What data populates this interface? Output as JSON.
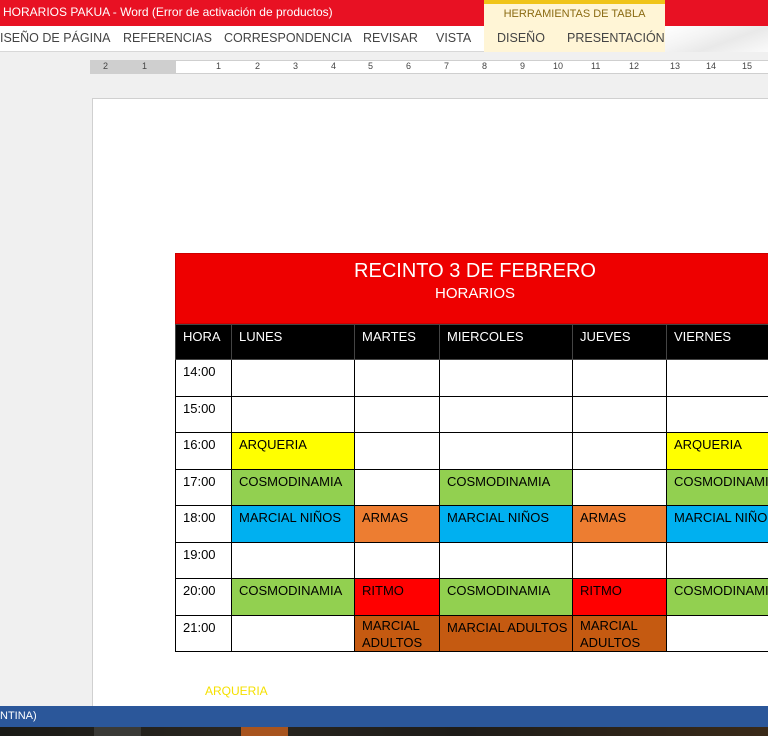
{
  "window": {
    "title": "HORARIOS PAKUA -  Word (Error de activación de productos)",
    "context_tab_group": "HERRAMIENTAS DE TABLA"
  },
  "ribbon": {
    "tabs": [
      "ISEÑO DE PÁGINA",
      "REFERENCIAS",
      "CORRESPONDENCIA",
      "REVISAR",
      "VISTA",
      "DISEÑO",
      "PRESENTACIÓN"
    ]
  },
  "ruler": {
    "numbers": [
      "2",
      "1",
      "1",
      "2",
      "3",
      "4",
      "5",
      "6",
      "7",
      "8",
      "9",
      "10",
      "11",
      "12",
      "13",
      "14",
      "15"
    ]
  },
  "schedule": {
    "title": "RECINTO 3 DE FEBRERO",
    "subtitle": "HORARIOS",
    "columns": [
      "HORA",
      "LUNES",
      "MARTES",
      "MIERCOLES",
      "JUEVES",
      "VIERNES"
    ],
    "rows": [
      {
        "hora": "14:00",
        "cells": [
          {
            "text": "",
            "color": ""
          },
          {
            "text": "",
            "color": ""
          },
          {
            "text": "",
            "color": ""
          },
          {
            "text": "",
            "color": ""
          },
          {
            "text": "",
            "color": ""
          }
        ]
      },
      {
        "hora": "15:00",
        "cells": [
          {
            "text": "",
            "color": ""
          },
          {
            "text": "",
            "color": ""
          },
          {
            "text": "",
            "color": ""
          },
          {
            "text": "",
            "color": ""
          },
          {
            "text": "",
            "color": ""
          }
        ]
      },
      {
        "hora": "16:00",
        "cells": [
          {
            "text": "ARQUERIA",
            "color": "yellow"
          },
          {
            "text": "",
            "color": ""
          },
          {
            "text": "",
            "color": ""
          },
          {
            "text": "",
            "color": ""
          },
          {
            "text": "ARQUERIA",
            "color": "yellow"
          }
        ]
      },
      {
        "hora": "17:00",
        "cells": [
          {
            "text": "COSMODINAMIA",
            "color": "green"
          },
          {
            "text": "",
            "color": ""
          },
          {
            "text": "COSMODINAMIA",
            "color": "green"
          },
          {
            "text": "",
            "color": ""
          },
          {
            "text": "COSMODINAMIA",
            "color": "green"
          }
        ]
      },
      {
        "hora": "18:00",
        "cells": [
          {
            "text": "MARCIAL NIÑOS",
            "color": "blue"
          },
          {
            "text": "ARMAS",
            "color": "orange"
          },
          {
            "text": "MARCIAL NIÑOS",
            "color": "blue"
          },
          {
            "text": "ARMAS",
            "color": "orange"
          },
          {
            "text": "MARCIAL NIÑOS",
            "color": "blue"
          }
        ]
      },
      {
        "hora": "19:00",
        "cells": [
          {
            "text": "",
            "color": ""
          },
          {
            "text": "",
            "color": ""
          },
          {
            "text": "",
            "color": ""
          },
          {
            "text": "",
            "color": ""
          },
          {
            "text": "",
            "color": ""
          }
        ]
      },
      {
        "hora": "20:00",
        "cells": [
          {
            "text": "COSMODINAMIA",
            "color": "green"
          },
          {
            "text": "RITMO",
            "color": "red"
          },
          {
            "text": "COSMODINAMIA",
            "color": "green"
          },
          {
            "text": "RITMO",
            "color": "red"
          },
          {
            "text": "COSMODINAMIA",
            "color": "green"
          }
        ]
      },
      {
        "hora": "21:00",
        "cells": [
          {
            "text": "",
            "color": ""
          },
          {
            "text": "MARCIAL ADULTOS",
            "color": "brown"
          },
          {
            "text": "MARCIAL ADULTOS",
            "color": "brown"
          },
          {
            "text": "MARCIAL ADULTOS",
            "color": "brown"
          },
          {
            "text": "",
            "color": ""
          }
        ]
      }
    ]
  },
  "below_table_text": "ARQUERIA",
  "status_bar": {
    "language": "NTINA)"
  },
  "colors": {
    "title_bar": "#e81123",
    "status_bar": "#2b579a",
    "table_header": "#ee0000",
    "yellow": "#ffff00",
    "green": "#92d050",
    "blue": "#00b0f0",
    "orange": "#ed7d31",
    "red": "#ff0000",
    "brown": "#c55a11"
  }
}
